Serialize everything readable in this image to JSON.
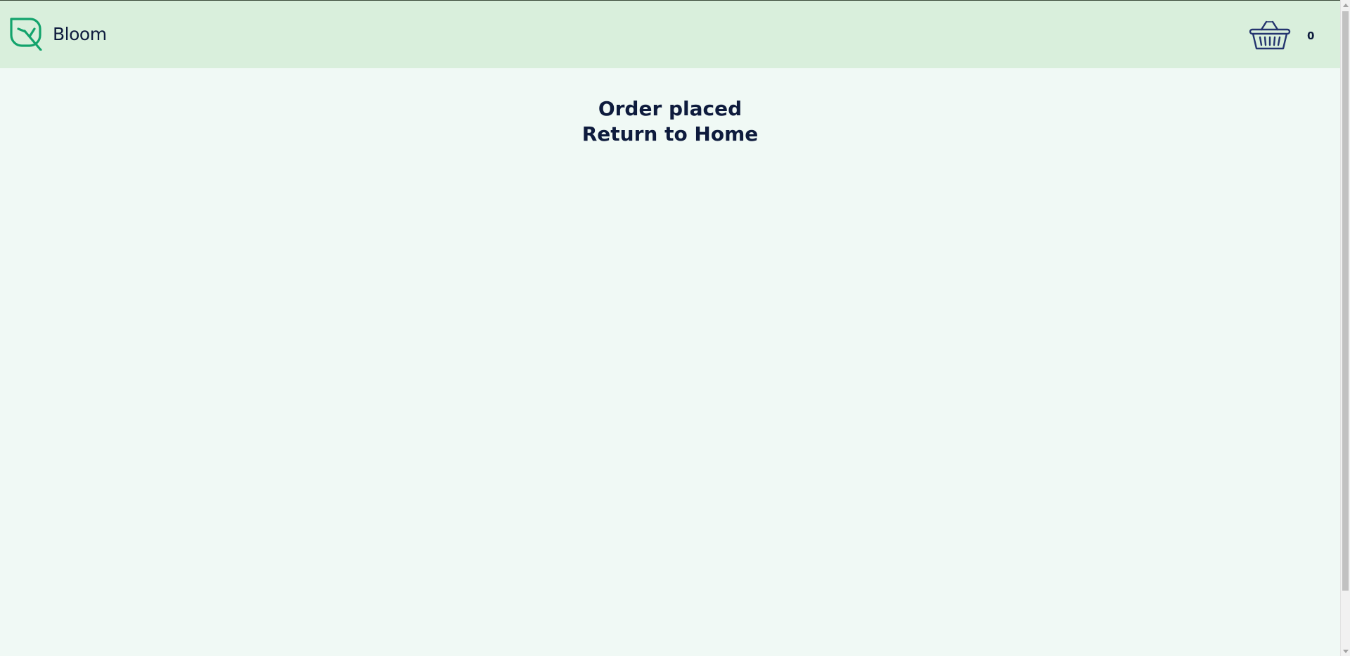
{
  "header": {
    "brand_name": "Bloom",
    "logo_icon": "leaf-icon",
    "cart_icon": "basket-icon",
    "cart_count": "0"
  },
  "main": {
    "heading": "Order placed",
    "return_link": "Return to Home"
  },
  "colors": {
    "header_bg": "#d9efdc",
    "page_bg": "#f0f9f5",
    "text": "#0e1b3d",
    "logo_green": "#12a36c",
    "basket_navy": "#24346f"
  }
}
